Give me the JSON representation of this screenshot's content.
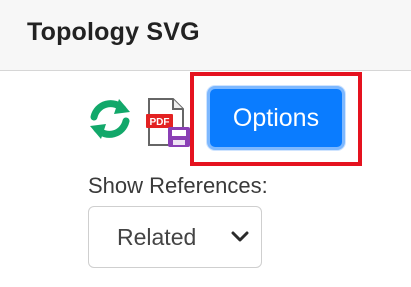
{
  "header": {
    "title": "Topology SVG"
  },
  "toolbar": {
    "refresh_icon": "refresh-icon",
    "pdf_icon": "pdf-export-icon",
    "options_label": "Options",
    "accent_color": "#0a7cff",
    "highlight_color": "#e5121f"
  },
  "references": {
    "label": "Show References:",
    "selected": "Related"
  },
  "icons": {
    "pdf_badge": "PDF"
  }
}
